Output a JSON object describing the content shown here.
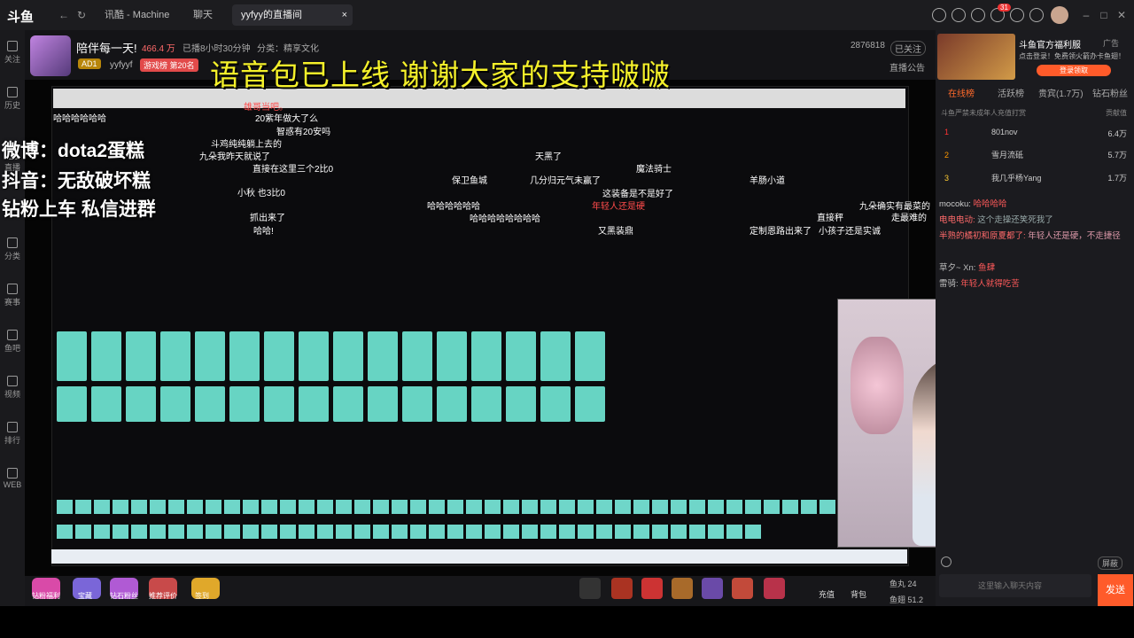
{
  "topbar": {
    "logo": "斗鱼",
    "tabs": [
      {
        "label": "讯酷 - Machine"
      },
      {
        "label": "聊天"
      },
      {
        "label": "yyfyy的直播间"
      }
    ],
    "tab_close": "×",
    "notif_count": "31"
  },
  "sidebar": {
    "items": [
      {
        "label": "关注"
      },
      {
        "label": "历史"
      },
      {
        "label": "直播"
      },
      {
        "label": "分类"
      },
      {
        "label": "赛事"
      },
      {
        "label": "鱼吧"
      },
      {
        "label": "视频"
      },
      {
        "label": "排行"
      },
      {
        "label": "WEB"
      }
    ]
  },
  "room": {
    "title": "陪伴每一天!",
    "heat": "466.4 万",
    "live_time": "已播8小时30分钟",
    "category": "分类：精享文化",
    "room_id": "2876818",
    "follow_state": "已关注",
    "report": "直播公告",
    "badge_name": "yyfyyf",
    "game_tag": "游戏榜",
    "rank_tag": "第20名"
  },
  "stream": {
    "big_overlay": "语音包已上线 谢谢大家的支持啵啵",
    "left_overlay": [
      "微博：dota2蛋糕",
      "抖音：无敌破坏糕",
      "钻粉上车 私信进群"
    ],
    "danmu": [
      "哈哈哈哈哈哈",
      "雄哥当吧。",
      "20紫年做大了么",
      "智惑有20安吗",
      "九朵我昨天就说了",
      "斗鸡纯纯躺上去的",
      "直接在这里三个2比0",
      "小秋  也3比0",
      "抓出来了",
      "哈哈!",
      "天黑了",
      "保卫鱼城",
      "几分归元气未赢了",
      "魔法骑士",
      "羊肠小道",
      "直接秤",
      "又黑装鼎",
      "定制恩路出来了",
      "小孩子还是实诚",
      "走最难的",
      "九朵确实有最菜的",
      "年轻人还是硬",
      "哈哈哈哈哈哈",
      "这装备是不是好了",
      "哈哈哈哈哈哈哈哈"
    ]
  },
  "bottom": {
    "gifts": [
      "钻粉福利",
      "宝藏",
      "钻石粉丝",
      "推荐评价",
      "签到"
    ],
    "charge": "充值",
    "bag": "背包",
    "fish_pill": "鱼丸 24",
    "fish_ball": "鱼翅 51.2"
  },
  "right": {
    "ad_title": "斗鱼官方福利服",
    "ad_sub": "点击登录！免费领火箭办卡鱼翅！",
    "ad_btn": "登录领取",
    "ad_tag": "广告",
    "tabs": [
      "在线榜",
      "活跃榜",
      "贵宾(1.7万)",
      "钻石粉丝"
    ],
    "rank_header": "斗鱼严禁未成年人充值打赏",
    "contribution": "贡献值",
    "ranks": [
      {
        "n": "1",
        "name": "801nov",
        "val": "6.4万"
      },
      {
        "n": "2",
        "name": "雪月流砥",
        "val": "5.7万"
      },
      {
        "n": "3",
        "name": "我几乎杨Yang",
        "val": "1.7万"
      }
    ],
    "chat": [
      {
        "user": "mocoku:",
        "msg": "哈哈哈哈"
      },
      {
        "user": "电电电动:",
        "msg": "这个走操还笑死我了"
      },
      {
        "user": "半熟的橘初和原夏都了:",
        "msg": "年轻人还是硬，不走捷径"
      },
      {
        "user": "草夕~ Xn:",
        "msg": "鱼肆"
      },
      {
        "user": "雷骑:",
        "msg": "年轻人就得吃苦"
      }
    ],
    "chat_placeholder": "这里输入聊天内容",
    "send": "发送",
    "hide_label": "屏蔽"
  }
}
